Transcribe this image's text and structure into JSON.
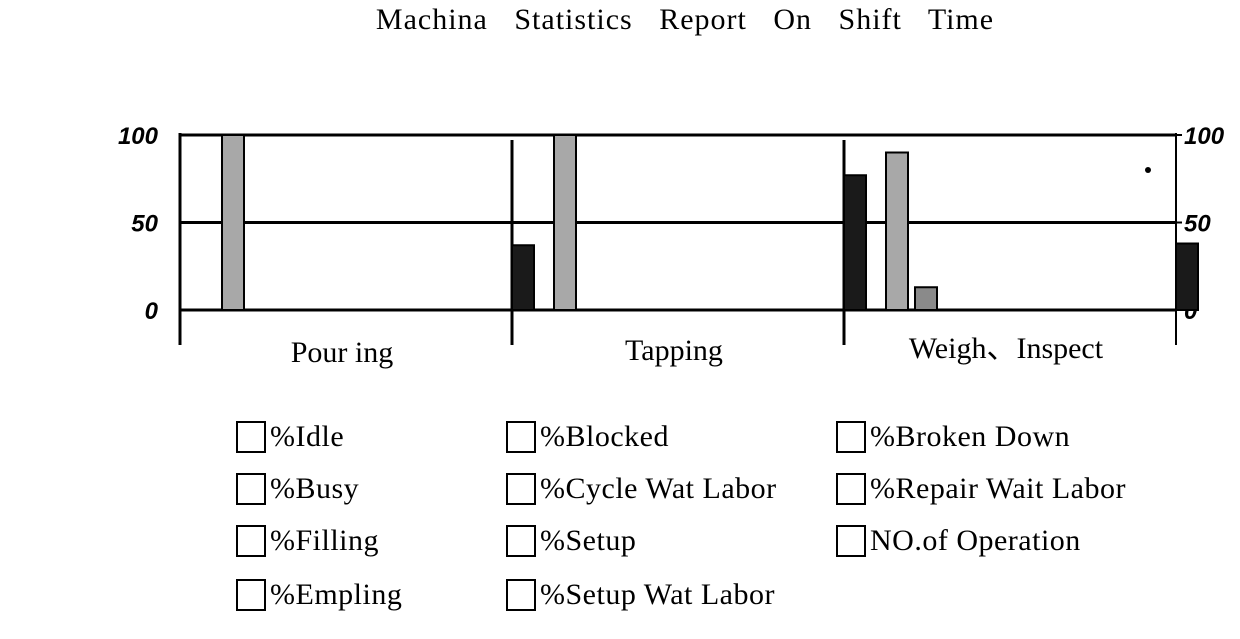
{
  "chart_data": {
    "type": "bar",
    "title": "Machina  Statistics  Report  On  Shift  Time",
    "xlabel": "",
    "ylabel": "",
    "ylim": [
      0,
      100
    ],
    "yticks": [
      "0",
      "50",
      "100"
    ],
    "yticks_right": [
      "0",
      "50",
      "100"
    ],
    "grid": true,
    "categories": [
      "Pour ing",
      "Tapping",
      "Weigh、Inspect"
    ],
    "series": [
      {
        "name": "%Idle",
        "values": [
          100,
          100,
          90
        ],
        "color": "#a8a8a8",
        "position": 0
      },
      {
        "name": "%Busy",
        "values": [
          0,
          0,
          13
        ],
        "color": "#8a8a8a",
        "position": 1
      },
      {
        "name": "NO.of Operation",
        "values": [
          37,
          77,
          38
        ],
        "color": "#1a1a1a",
        "position": 10
      }
    ],
    "markers": [
      {
        "category": "Weigh、Inspect",
        "value": 80
      }
    ],
    "legend_position": "bottom",
    "legend": [
      [
        "%Idle",
        "%Busy",
        "%Filling",
        "%Empling"
      ],
      [
        "%Blocked",
        "%Cycle Wat Labor",
        "%Setup",
        "%Setup Wat Labor"
      ],
      [
        "%Broken Down",
        "%Repair Wait Labor",
        "NO.of Operation"
      ]
    ]
  }
}
